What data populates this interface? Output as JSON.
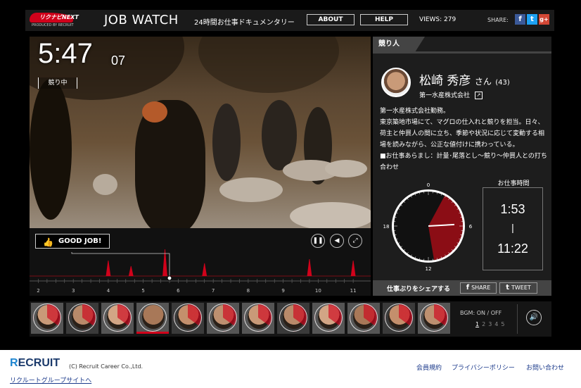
{
  "header": {
    "logo_text": "リクナビNEXT",
    "produced_by": "PRODUCED BY RECRUIT",
    "site_title": "JOB WATCH",
    "subtitle": "24時間お仕事ドキュメンタリー",
    "about_label": "ABOUT",
    "help_label": "HELP",
    "views": "VIEWS: 279",
    "share_label": "SHARE:",
    "share_icons": [
      "facebook-icon",
      "twitter-icon",
      "google-plus-icon"
    ]
  },
  "video": {
    "clock_hm": "5:47",
    "clock_sec": "07",
    "status": "競り中"
  },
  "timeline": {
    "goodjob_label": "GOOD JOB!",
    "controls": [
      "pause-icon",
      "rewind-icon",
      "fullscreen-icon"
    ],
    "hour_ticks": [
      "2",
      "3",
      "4",
      "5",
      "6",
      "7",
      "8",
      "9",
      "10",
      "11"
    ],
    "spikes": [
      {
        "hour": 4.0,
        "level": 0.55
      },
      {
        "hour": 4.65,
        "level": 0.35
      },
      {
        "hour": 5.62,
        "level": 0.95
      },
      {
        "hour": 6.75,
        "level": 0.45
      },
      {
        "hour": 9.75,
        "level": 0.6
      },
      {
        "hour": 11.0,
        "level": 0.55
      }
    ],
    "playhead_hour": 5.75,
    "range": [
      1.75,
      11.5
    ],
    "accent_color": "#d0021b"
  },
  "profile": {
    "section_title": "競り人",
    "name": "松崎 秀彦",
    "name_suffix": "さん",
    "age": "(43)",
    "company": "第一水産株式会社",
    "bio": [
      "第一水産株式会社勤務。",
      "東京築地市場にて、マグロの仕入れと競りを担当。日々、荷主と仲買人の間に立ち、季節や状況に応じて変動する相場を読みながら、公正な値付けに携わっている。",
      "■お仕事あらまし：計量･尾落とし～競り～仲買人との打ち合わせ"
    ],
    "dial_labels": [
      "0",
      "6",
      "12",
      "18"
    ],
    "work_start_hours": 1.883,
    "work_end_hours": 11.367,
    "current_time_hours": 5.785,
    "worktime_title": "お仕事時間",
    "work_start": "1:53",
    "work_sep": "|",
    "work_end": "11:22",
    "share_work_label": "仕事ぶりをシェアする",
    "share_fb_label": "SHARE",
    "share_tw_label": "TWEET"
  },
  "thumbnails": {
    "count": 12,
    "active_index": 3,
    "bgm_label": "BGM: ON / OFF",
    "bgm_pages": [
      "1",
      "2",
      "3",
      "4",
      "5"
    ],
    "bgm_current": "1"
  },
  "footer": {
    "logo": "RECRUIT",
    "copyright": "(C) Recruit Career Co.,Ltd.",
    "group_link": "リクルートグループサイトへ",
    "terms": "会員規約",
    "privacy": "プライバシーポリシー",
    "contact": "お問い合わせ"
  }
}
